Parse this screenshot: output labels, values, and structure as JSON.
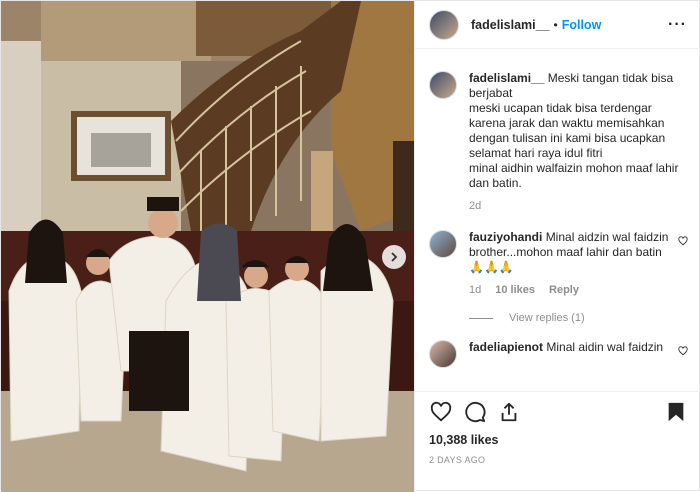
{
  "post": {
    "username": "fadelislami__",
    "follow_label": "Follow",
    "separator": "•",
    "more_icon": "more-horizontal-icon",
    "caption": {
      "username": "fadelislami__",
      "text": "Meski tangan tidak bisa berjabat\nmeski ucapan tidak bisa terdengar karena jarak dan waktu memisahkan dengan tulisan ini kami bisa ucapkan selamat hari raya idul fitri\nminal aidhin walfaizin mohon maaf lahir dan batin.",
      "time": "2d"
    },
    "comments": [
      {
        "username": "fauziyohandi",
        "text": "Minal aidzin wal faidzin brother...mohon maaf lahir dan batin 🙏🙏🙏",
        "time": "1d",
        "likes": "10 likes",
        "reply_label": "Reply",
        "view_replies": "View replies (1)"
      },
      {
        "username": "fadeliapienot",
        "text": "Minal aidin wal faidzin",
        "time": "",
        "likes": "",
        "reply_label": ""
      }
    ],
    "likes": "10,388 likes",
    "posted_ago": "2 days ago",
    "icons": {
      "like": "heart-icon",
      "comment": "comment-icon",
      "share": "share-icon",
      "save": "bookmark-icon",
      "next": "chevron-right-icon"
    }
  }
}
